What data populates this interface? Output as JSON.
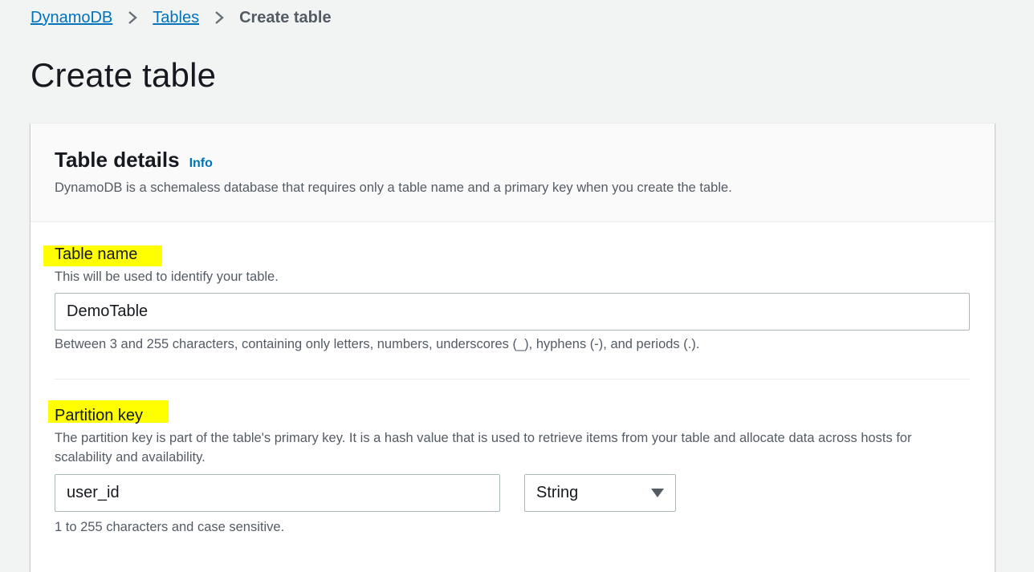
{
  "breadcrumb": {
    "items": [
      "DynamoDB",
      "Tables"
    ],
    "current": "Create table"
  },
  "page": {
    "title": "Create table"
  },
  "panel": {
    "title": "Table details",
    "info": "Info",
    "description": "DynamoDB is a schemaless database that requires only a table name and a primary key when you create the table."
  },
  "table_name": {
    "label": "Table name",
    "description": "This will be used to identify your table.",
    "value": "DemoTable",
    "constraint": "Between 3 and 255 characters, containing only letters, numbers, underscores (_), hyphens (-), and periods (.)."
  },
  "partition_key": {
    "label": "Partition key",
    "description": "The partition key is part of the table's primary key. It is a hash value that is used to retrieve items from your table and allocate data across hosts for scalability and availability.",
    "value": "user_id",
    "type": "String",
    "constraint": "1 to 255 characters and case sensitive."
  },
  "colors": {
    "link": "#0073bb",
    "highlight": "#ffff00",
    "background": "#f2f3f3"
  }
}
